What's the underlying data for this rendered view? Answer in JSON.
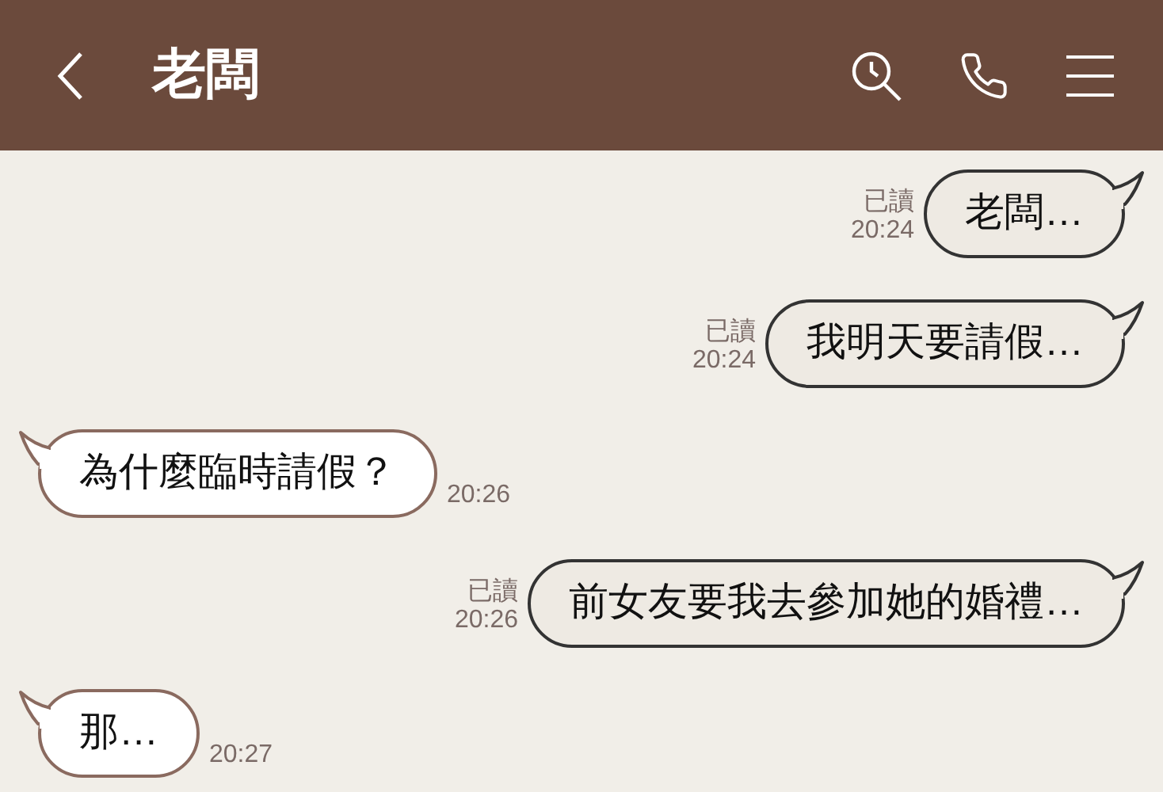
{
  "header": {
    "title": "老闆"
  },
  "messages": [
    {
      "kind": "sent",
      "text": "老闆…",
      "read": "已讀",
      "time": "20:24"
    },
    {
      "kind": "sent",
      "text": "我明天要請假…",
      "read": "已讀",
      "time": "20:24"
    },
    {
      "kind": "received",
      "text": "為什麼臨時請假？",
      "time": "20:26"
    },
    {
      "kind": "sent",
      "text": "前女友要我去參加她的婚禮…",
      "read": "已讀",
      "time": "20:26"
    },
    {
      "kind": "received",
      "text": "那…",
      "time": "20:27"
    }
  ]
}
